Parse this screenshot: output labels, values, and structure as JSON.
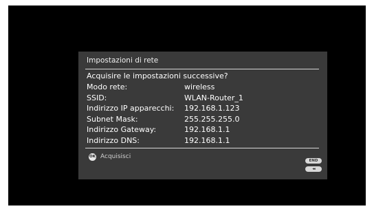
{
  "dialog": {
    "title": "Impostazioni di rete",
    "question": "Acquisire le impostazioni successive?",
    "rows": [
      {
        "label": "Modo rete:",
        "value": "wireless"
      },
      {
        "label": "SSID:",
        "value": "WLAN-Router_1"
      },
      {
        "label": "Indirizzo IP apparecchi:",
        "value": "192.168.1.123"
      },
      {
        "label": "Subnet Mask:",
        "value": "255.255.255.0"
      },
      {
        "label": "Indirizzo Gateway:",
        "value": "192.168.1.1"
      },
      {
        "label": "Indirizzo DNS:",
        "value": "192.168.1.1"
      }
    ],
    "action": {
      "icon_text": "OK",
      "icon": "ok-button-icon",
      "label": "Acquisisci"
    },
    "end_button": {
      "label": "END",
      "icon": "end-button-icon"
    },
    "back_button": {
      "label": "◂◂",
      "icon": "rewind-back-icon"
    }
  },
  "colors": {
    "screen_bg": "#000000",
    "dialog_bg": "#3a3a3a",
    "text": "#ffffff",
    "divider": "#d8d8d8"
  }
}
